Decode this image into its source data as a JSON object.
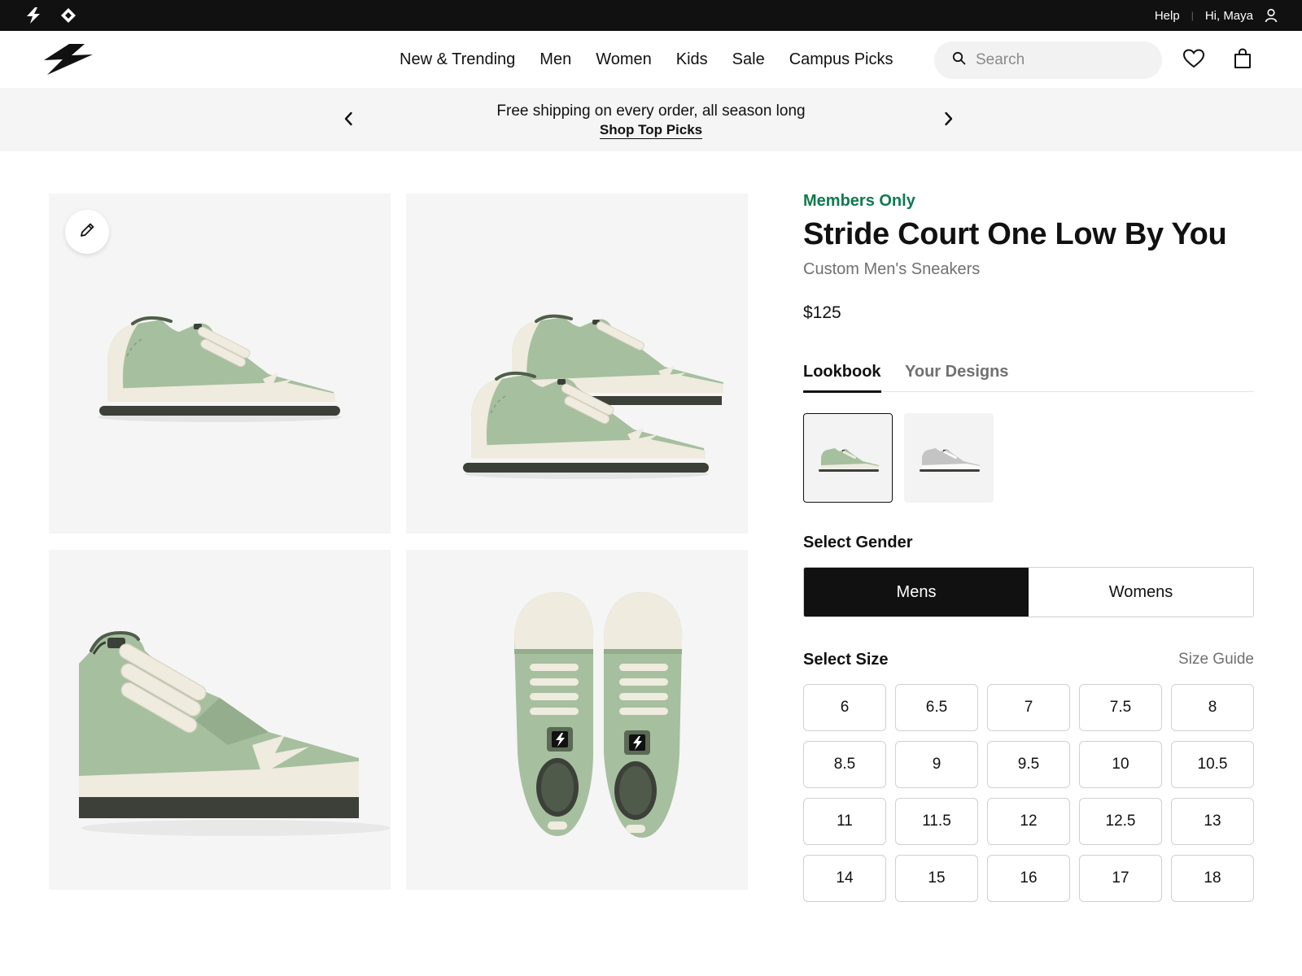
{
  "utility_bar": {
    "help": "Help",
    "greeting": "Hi, Maya"
  },
  "header": {
    "nav": [
      "New & Trending",
      "Men",
      "Women",
      "Kids",
      "Sale",
      "Campus Picks"
    ],
    "search_placeholder": "Search"
  },
  "promo": {
    "text": "Free shipping on every order, all season long",
    "link": "Shop Top Picks"
  },
  "product": {
    "eyebrow": "Members Only",
    "title": "Stride Court One Low By You",
    "subtitle": "Custom Men's Sneakers",
    "price": "$125"
  },
  "tabs": [
    "Lookbook",
    "Your Designs"
  ],
  "gender": {
    "label": "Select Gender",
    "options": [
      "Mens",
      "Womens"
    ],
    "selected": "Mens"
  },
  "size": {
    "label": "Select Size",
    "guide": "Size Guide",
    "options": [
      "6",
      "6.5",
      "7",
      "7.5",
      "8",
      "8.5",
      "9",
      "9.5",
      "10",
      "10.5",
      "11",
      "11.5",
      "12",
      "12.5",
      "13",
      "14",
      "15",
      "16",
      "17",
      "18"
    ]
  },
  "icons": {
    "utility": [
      "bolt-icon",
      "diamond-icon",
      "user-icon"
    ],
    "header": [
      "brand-logo-icon",
      "search-icon",
      "heart-icon",
      "bag-icon"
    ],
    "promo": [
      "chevron-left-icon",
      "chevron-right-icon"
    ],
    "gallery": [
      "pencil-icon"
    ]
  },
  "colors": {
    "accent_green": "#0f7a4f",
    "shoe_green": "#a6bf9f",
    "shoe_cream": "#efebdf",
    "sole_dark": "#3c4038",
    "swatch_grey": "#c4c4c4"
  }
}
